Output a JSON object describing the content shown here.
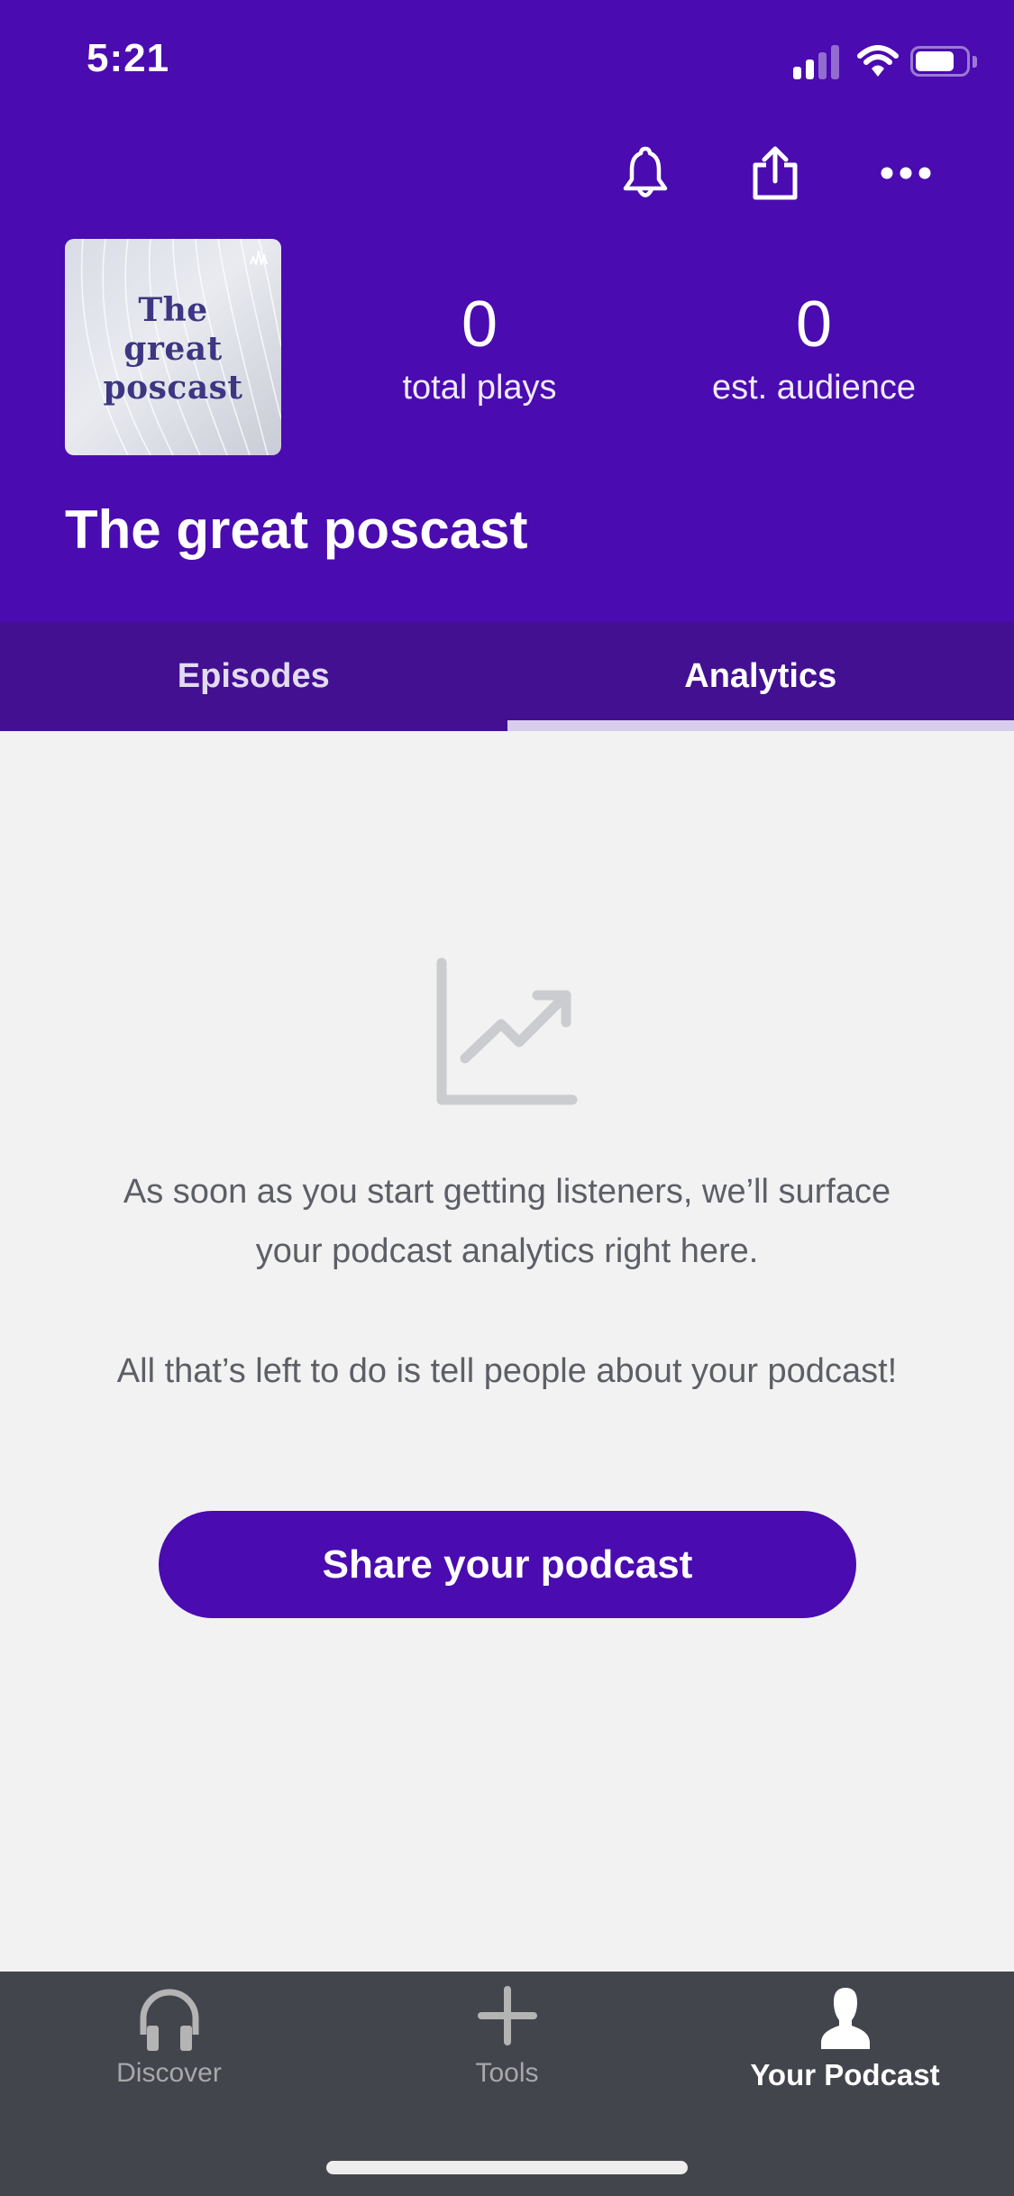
{
  "status_bar": {
    "time": "5:21",
    "icons": [
      "signal-icon",
      "wifi-icon",
      "battery-icon"
    ]
  },
  "header": {
    "actions": [
      {
        "name": "notifications",
        "icon": "bell-icon"
      },
      {
        "name": "share",
        "icon": "share-icon"
      },
      {
        "name": "more",
        "icon": "more-dots-icon"
      }
    ],
    "cover_art": {
      "line1": "The",
      "line2": "great",
      "line3": "poscast"
    },
    "stats": [
      {
        "value": "0",
        "label": "total plays"
      },
      {
        "value": "0",
        "label": "est. audience"
      }
    ],
    "podcast_title": "The great poscast"
  },
  "tabs": [
    {
      "label": "Episodes",
      "active": false
    },
    {
      "label": "Analytics",
      "active": true
    }
  ],
  "empty_state": {
    "icon": "trending-chart-icon",
    "message1": "As soon as you start getting listeners, we’ll surface your podcast analytics right here.",
    "message2": "All that’s left to do is tell people about your podcast!",
    "button_label": "Share your podcast"
  },
  "bottom_nav": {
    "items": [
      {
        "label": "Discover",
        "icon": "headphones-icon",
        "active": false
      },
      {
        "label": "Tools",
        "icon": "plus-icon",
        "active": false
      },
      {
        "label": "Your Podcast",
        "icon": "user-icon",
        "active": true
      }
    ]
  },
  "colors": {
    "brand_purple": "#4a0bb0",
    "tab_bar": "#421091",
    "tab_indicator": "#d8cdeb",
    "background": "#f2f2f2",
    "bottom_nav": "#43454c",
    "empty_icon": "#cbcccf",
    "body_text": "#5d5f66"
  }
}
